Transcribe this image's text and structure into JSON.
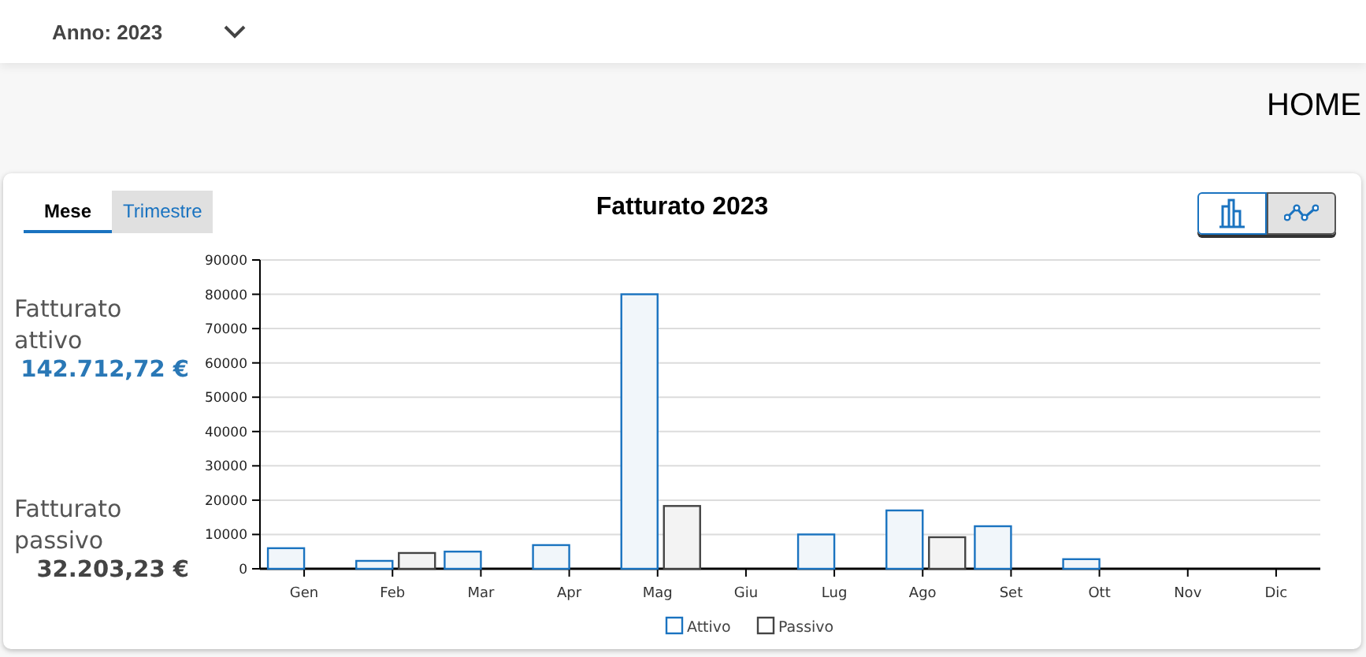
{
  "filter": {
    "label": "Anno: 2023"
  },
  "page_title": "HOME",
  "tabs": [
    {
      "label": "Mese",
      "selected": true
    },
    {
      "label": "Trimestre",
      "selected": false
    }
  ],
  "card_title": "Fatturato 2023",
  "view_toggle": [
    {
      "kind": "bar",
      "selected": true
    },
    {
      "kind": "line",
      "selected": false
    }
  ],
  "summary": [
    {
      "kind": "attivo",
      "label": "Fatturato attivo",
      "value": "142.712,72 €"
    },
    {
      "kind": "passivo",
      "label": "Fatturato passivo",
      "value": "32.203,23 €"
    }
  ],
  "chart_data": {
    "type": "bar",
    "categories": [
      "Gen",
      "Feb",
      "Mar",
      "Apr",
      "Mag",
      "Giu",
      "Lug",
      "Ago",
      "Set",
      "Ott",
      "Nov",
      "Dic"
    ],
    "series": [
      {
        "name": "Attivo",
        "color": "#1a73c0",
        "values": [
          6000,
          2300,
          5000,
          6900,
          80000,
          0,
          10000,
          17000,
          12400,
          2800,
          0,
          0
        ]
      },
      {
        "name": "Passivo",
        "color": "#444444",
        "values": [
          0,
          4600,
          0,
          0,
          18300,
          0,
          0,
          9200,
          0,
          0,
          0,
          0
        ]
      }
    ],
    "grid": true,
    "legend": true,
    "ylim": [
      0,
      90000
    ],
    "yticks": [
      0,
      10000,
      20000,
      30000,
      40000,
      50000,
      60000,
      70000,
      80000,
      90000
    ]
  }
}
